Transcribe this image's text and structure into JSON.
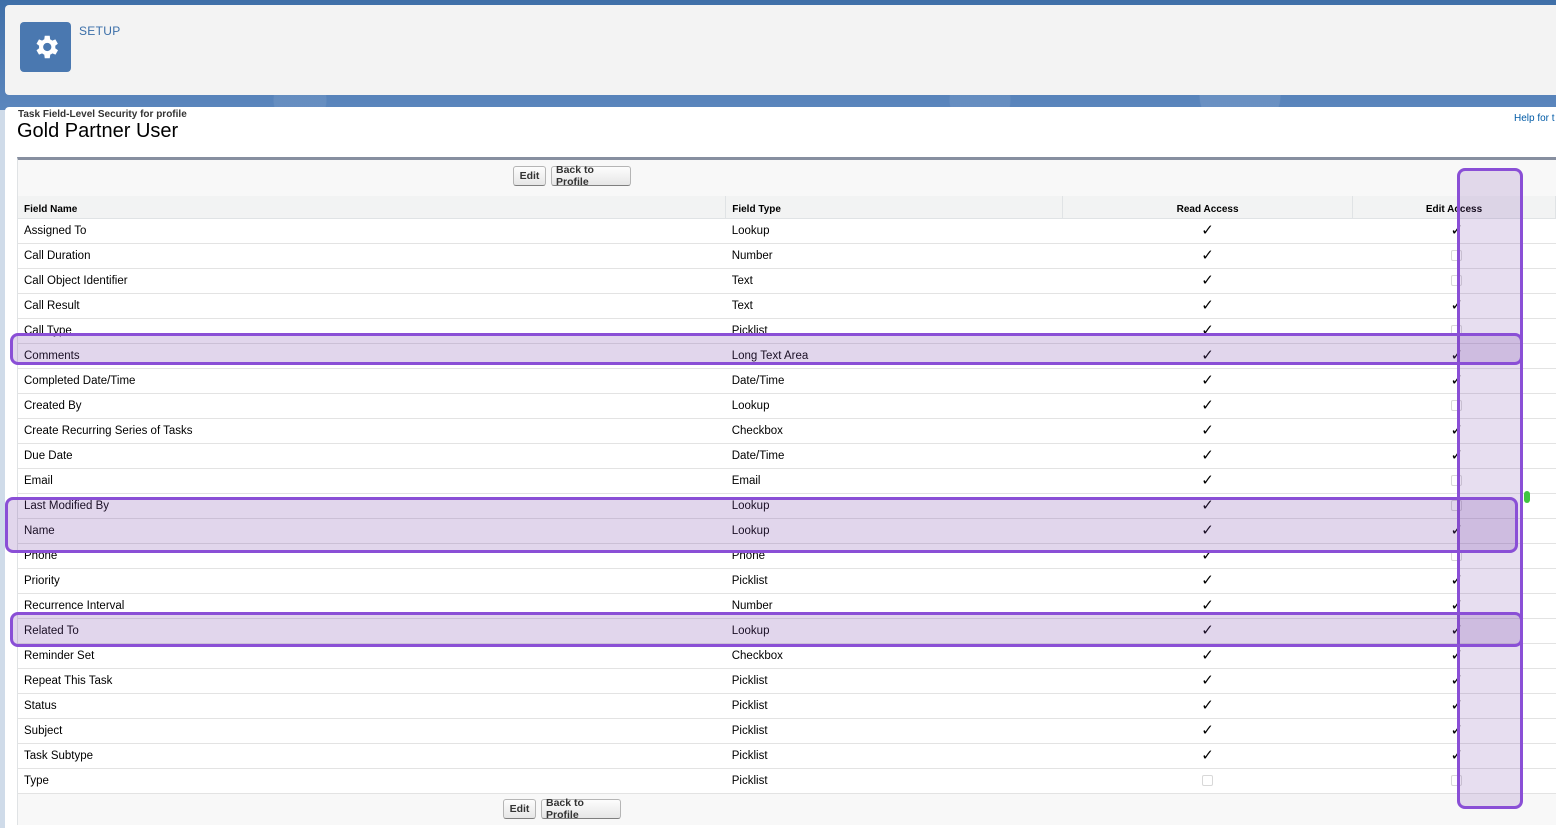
{
  "header": {
    "setup_label": "SETUP",
    "icon": "gear-icon"
  },
  "page": {
    "breadcrumb": "Task Field-Level Security for profile",
    "title": "Gold Partner User",
    "help_link": "Help for t"
  },
  "buttons": {
    "edit": "Edit",
    "back": "Back to Profile"
  },
  "table": {
    "columns": [
      "Field Name",
      "Field Type",
      "Read Access",
      "Edit Access"
    ],
    "rows": [
      {
        "name": "Assigned To",
        "type": "Lookup",
        "read": true,
        "edit": true
      },
      {
        "name": "Call Duration",
        "type": "Number",
        "read": true,
        "edit": false
      },
      {
        "name": "Call Object Identifier",
        "type": "Text",
        "read": true,
        "edit": false
      },
      {
        "name": "Call Result",
        "type": "Text",
        "read": true,
        "edit": true
      },
      {
        "name": "Call Type",
        "type": "Picklist",
        "read": true,
        "edit": false
      },
      {
        "name": "Comments",
        "type": "Long Text Area",
        "read": true,
        "edit": true
      },
      {
        "name": "Completed Date/Time",
        "type": "Date/Time",
        "read": true,
        "edit": true
      },
      {
        "name": "Created By",
        "type": "Lookup",
        "read": true,
        "edit": false
      },
      {
        "name": "Create Recurring Series of Tasks",
        "type": "Checkbox",
        "read": true,
        "edit": true
      },
      {
        "name": "Due Date",
        "type": "Date/Time",
        "read": true,
        "edit": true
      },
      {
        "name": "Email",
        "type": "Email",
        "read": true,
        "edit": false
      },
      {
        "name": "Last Modified By",
        "type": "Lookup",
        "read": true,
        "edit": false
      },
      {
        "name": "Name",
        "type": "Lookup",
        "read": true,
        "edit": true
      },
      {
        "name": "Phone",
        "type": "Phone",
        "read": true,
        "edit": false
      },
      {
        "name": "Priority",
        "type": "Picklist",
        "read": true,
        "edit": true
      },
      {
        "name": "Recurrence Interval",
        "type": "Number",
        "read": true,
        "edit": true
      },
      {
        "name": "Related To",
        "type": "Lookup",
        "read": true,
        "edit": true
      },
      {
        "name": "Reminder Set",
        "type": "Checkbox",
        "read": true,
        "edit": true
      },
      {
        "name": "Repeat This Task",
        "type": "Picklist",
        "read": true,
        "edit": true
      },
      {
        "name": "Status",
        "type": "Picklist",
        "read": true,
        "edit": true
      },
      {
        "name": "Subject",
        "type": "Picklist",
        "read": true,
        "edit": true
      },
      {
        "name": "Task Subtype",
        "type": "Picklist",
        "read": true,
        "edit": true
      },
      {
        "name": "Type",
        "type": "Picklist",
        "read": false,
        "edit": false
      }
    ]
  },
  "colors": {
    "highlight": "#8a4fd6",
    "header_bg": "#3f6fa8",
    "link": "#015ba7"
  }
}
